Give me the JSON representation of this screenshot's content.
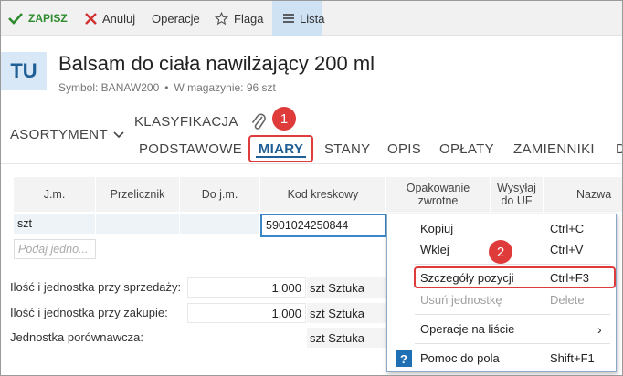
{
  "toolbar": {
    "save_label": "ZAPISZ",
    "cancel_label": "Anuluj",
    "operations_label": "Operacje",
    "flag_label": "Flaga",
    "list_label": "Lista"
  },
  "header": {
    "badge": "TU",
    "title": "Balsam do ciała nawilżający 200 ml",
    "symbol": "Symbol: BANAW200",
    "stock": "W magazynie: 96 szt"
  },
  "tabs": {
    "group_asortyment": "ASORTYMENT",
    "group_klasyfikacja": "KLASYFIKACJA",
    "items": [
      "PODSTAWOWE",
      "MIARY",
      "STANY",
      "OPIS",
      "OPŁATY",
      "ZAMIENNIKI",
      "D"
    ],
    "active": "MIARY"
  },
  "markers": {
    "one": "1",
    "two": "2"
  },
  "table": {
    "headers": [
      "J.m.",
      "Przelicznik",
      "Do j.m.",
      "Kod kreskowy",
      "Opakowanie zwrotne",
      "Wysyłaj do UF",
      "Nazwa"
    ],
    "row": {
      "unit": "szt",
      "converter": "",
      "to_unit": "",
      "barcode": "5901024250844"
    },
    "new_row_placeholder": "Podaj jedno..."
  },
  "form": {
    "sale_label": "Ilość i jednostka przy sprzedaży:",
    "sale_qty": "1,000",
    "sale_unit": "szt  Sztuka",
    "purchase_label": "Ilość i jednostka przy zakupie:",
    "purchase_qty": "1,000",
    "purchase_unit": "szt  Sztuka",
    "compare_label": "Jednostka porównawcza:",
    "compare_unit": "szt  Sztuka"
  },
  "context_menu": {
    "copy": {
      "label": "Kopiuj",
      "shortcut": "Ctrl+C"
    },
    "paste": {
      "label": "Wklej",
      "shortcut": "Ctrl+V"
    },
    "details": {
      "label": "Szczegóły pozycji",
      "shortcut": "Ctrl+F3"
    },
    "delete_unit": {
      "label": "Usuń jednostkę",
      "shortcut": "Delete"
    },
    "list_ops": {
      "label": "Operacje na liście"
    },
    "help": {
      "label": "Pomoc do pola",
      "shortcut": "Shift+F1"
    }
  },
  "colors": {
    "accent": "#1f5f95",
    "save_green": "#2e8b2e",
    "highlight_red": "#e03b3b",
    "list_active_bg": "#cfe2f3"
  }
}
